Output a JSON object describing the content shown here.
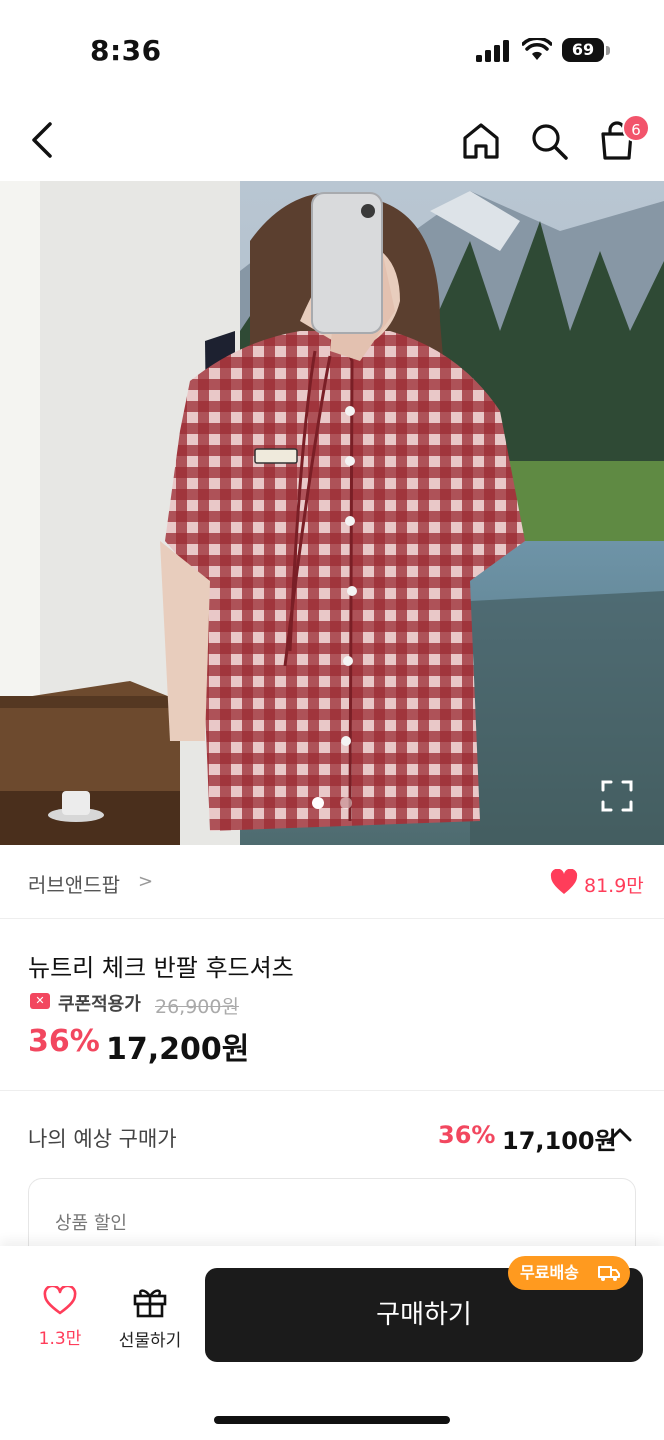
{
  "status_bar": {
    "time": "8:36",
    "battery": "69"
  },
  "nav": {
    "cart_count": "6"
  },
  "brand": {
    "name": "러브앤드팝",
    "arrow": ">",
    "likes": "81.9만"
  },
  "product": {
    "title": "뉴트리 체크 반팔 후드셔츠",
    "coupon_icon": "✕",
    "coupon_label": "쿠폰적용가",
    "original_price": "26,900원",
    "discount": "36%",
    "price": "17,200원"
  },
  "expected": {
    "label": "나의 예상 구매가",
    "discount": "36%",
    "price": "17,100원"
  },
  "discount_box": {
    "label": "상품 할인"
  },
  "bottom_bar": {
    "like_count": "1.3만",
    "gift_label": "선물하기",
    "buy_label": "구매하기",
    "free_shipping": "무료배송"
  },
  "colors": {
    "accent": "#f2475f",
    "like": "#ff3d5a",
    "badge": "#ff9a1f",
    "buy_button": "#1b1b1b"
  },
  "icons": [
    "back-icon",
    "home-icon",
    "search-icon",
    "cart-icon",
    "heart-icon",
    "gift-icon",
    "expand-icon",
    "chevron-up-icon",
    "truck-icon"
  ]
}
